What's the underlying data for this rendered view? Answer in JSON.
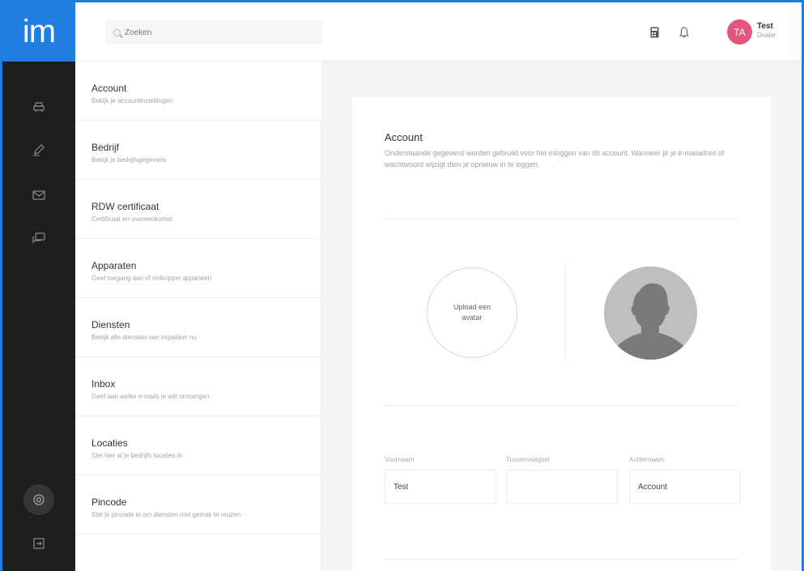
{
  "logo": "im",
  "search": {
    "placeholder": "Zoeken"
  },
  "header": {
    "user_initials": "TA",
    "user_name": "Test",
    "user_role": "Dealer"
  },
  "rail": {
    "icons": [
      "car-icon",
      "pencil-icon",
      "mail-icon",
      "chat-icon",
      "settings-icon",
      "logout-icon"
    ]
  },
  "menu": {
    "items": [
      {
        "title": "Account",
        "desc": "Bekijk je accountinstellingen"
      },
      {
        "title": "Bedrijf",
        "desc": "Bekijk je bedrijfsgegevens"
      },
      {
        "title": "RDW certificaat",
        "desc": "Certificaat en overeenkomst"
      },
      {
        "title": "Apparaten",
        "desc": "Geef toegang aan of ontkoppel apparaten"
      },
      {
        "title": "Diensten",
        "desc": "Bekijk alle diensten van Impalaon nu"
      },
      {
        "title": "Inbox",
        "desc": "Geef aan welke e-mails je wilt ontvangen"
      },
      {
        "title": "Locaties",
        "desc": "Stel hier al je bedrijfs locaties in"
      },
      {
        "title": "Pincode",
        "desc": "Stel je pincode in om diensten met gemak te reuzen"
      }
    ]
  },
  "account": {
    "title": "Account",
    "description": "Onderstaande gegevens worden gebruikt voor het inloggen van dit account. Wanneer je je e-mailadres of wachtwoord wijzigt dien je opnieuw in te loggen.",
    "upload_label": "Upload een avatar",
    "fields": [
      {
        "label": "Voornaam",
        "value": "Test"
      },
      {
        "label": "Tussenvoegsel",
        "value": ""
      },
      {
        "label": "Achternaam",
        "value": "Account"
      }
    ]
  },
  "colors": {
    "brand": "#1f7ee0",
    "avatar_badge": "#e4577d",
    "rail": "#1e1e1e"
  }
}
